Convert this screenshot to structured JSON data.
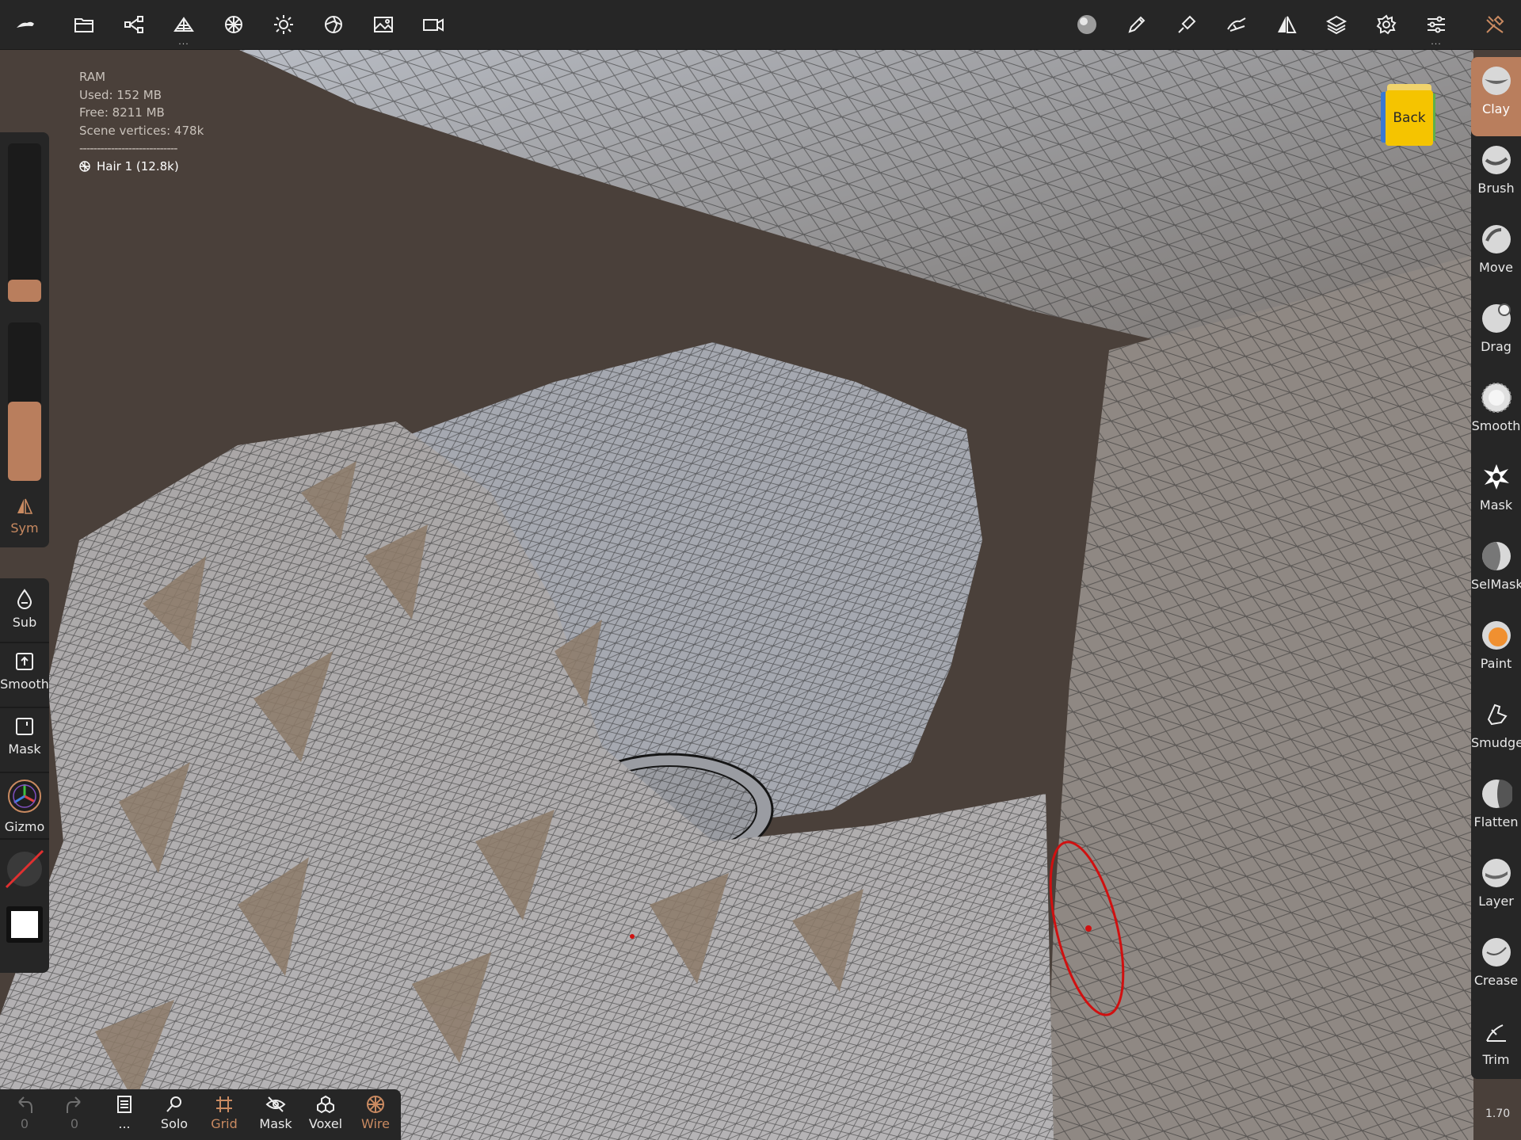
{
  "topbar": {
    "left_icons": [
      "app-logo-icon",
      "folder-icon",
      "scene-graph-icon",
      "mesh-primitives-icon",
      "topology-icon",
      "lighting-icon",
      "material-shading-icon",
      "image-export-icon",
      "video-icon"
    ],
    "right_icons": [
      "material-sphere-icon",
      "pen-icon",
      "stroke-icon",
      "pose-icon",
      "symmetry-icon",
      "layers-icon",
      "settings-icon",
      "sliders-icon",
      "tools-icon"
    ]
  },
  "info": {
    "ram": "RAM",
    "used": "Used: 152 MB",
    "free": "Free: 8211 MB",
    "vertices": "Scene vertices: 478k",
    "separator": "----------------------------",
    "object": "Hair 1 (12.8k)"
  },
  "left_panel": {
    "sym": "Sym",
    "sub": "Sub",
    "smooth": "Smooth",
    "mask": "Mask",
    "gizmo": "Gizmo",
    "radius_level": 0.1,
    "intensity_level": 0.5
  },
  "view_cube": {
    "label": "Back"
  },
  "tools": [
    "Clay",
    "Brush",
    "Move",
    "Drag",
    "Smooth",
    "Mask",
    "SelMask",
    "Paint",
    "Smudge",
    "Flatten",
    "Layer",
    "Crease",
    "Trim"
  ],
  "active_tool": "Clay",
  "bottom_bar": {
    "undo_count": "0",
    "redo_count": "0",
    "menu_more": "...",
    "solo": "Solo",
    "grid": "Grid",
    "mask": "Mask",
    "voxel": "Voxel",
    "wire": "Wire"
  },
  "version": "1.70",
  "colors": {
    "accent": "#b97e5d",
    "panel": "#262626",
    "background": "#4a403a",
    "cursor": "#d01010"
  }
}
